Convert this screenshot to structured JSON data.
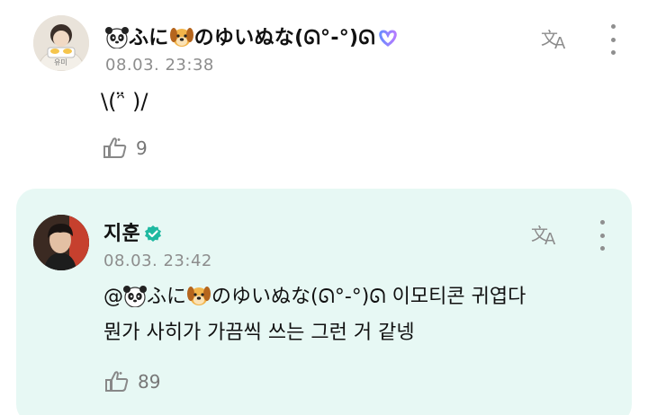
{
  "comments": [
    {
      "author": {
        "name_prefix": "ふに",
        "name_suffix": "のゆいぬな(ᘏ°-°)ᘏ",
        "emoji_1": "panda-face",
        "emoji_2": "dog-face",
        "avatar_label": "유미"
      },
      "timestamp": "08.03. 23:38",
      "text_lines": [
        "\\(ᵔ̈ )/"
      ],
      "like_count": "9"
    },
    {
      "author": {
        "name": "지훈",
        "verified": true
      },
      "timestamp": "08.03. 23:42",
      "mention": {
        "prefix": "@",
        "name_prefix": "ふに",
        "name_suffix": "のゆいぬな(ᘏ°-°)ᘏ"
      },
      "text_line_1_rest": " 이모티콘 귀엽다",
      "text_line_2": "뭔가 사히가 가끔씩 쓰는 그런 거 같넹",
      "like_count": "89"
    }
  ],
  "colors": {
    "highlight_bg": "#e7f8f4",
    "meta_text": "#8d8d8d",
    "verified": "#1fb9a1"
  },
  "icons": [
    "translate-icon",
    "more-vertical-icon",
    "like-icon",
    "verified-badge-icon",
    "heart-icon",
    "panda-emoji",
    "dog-emoji"
  ]
}
